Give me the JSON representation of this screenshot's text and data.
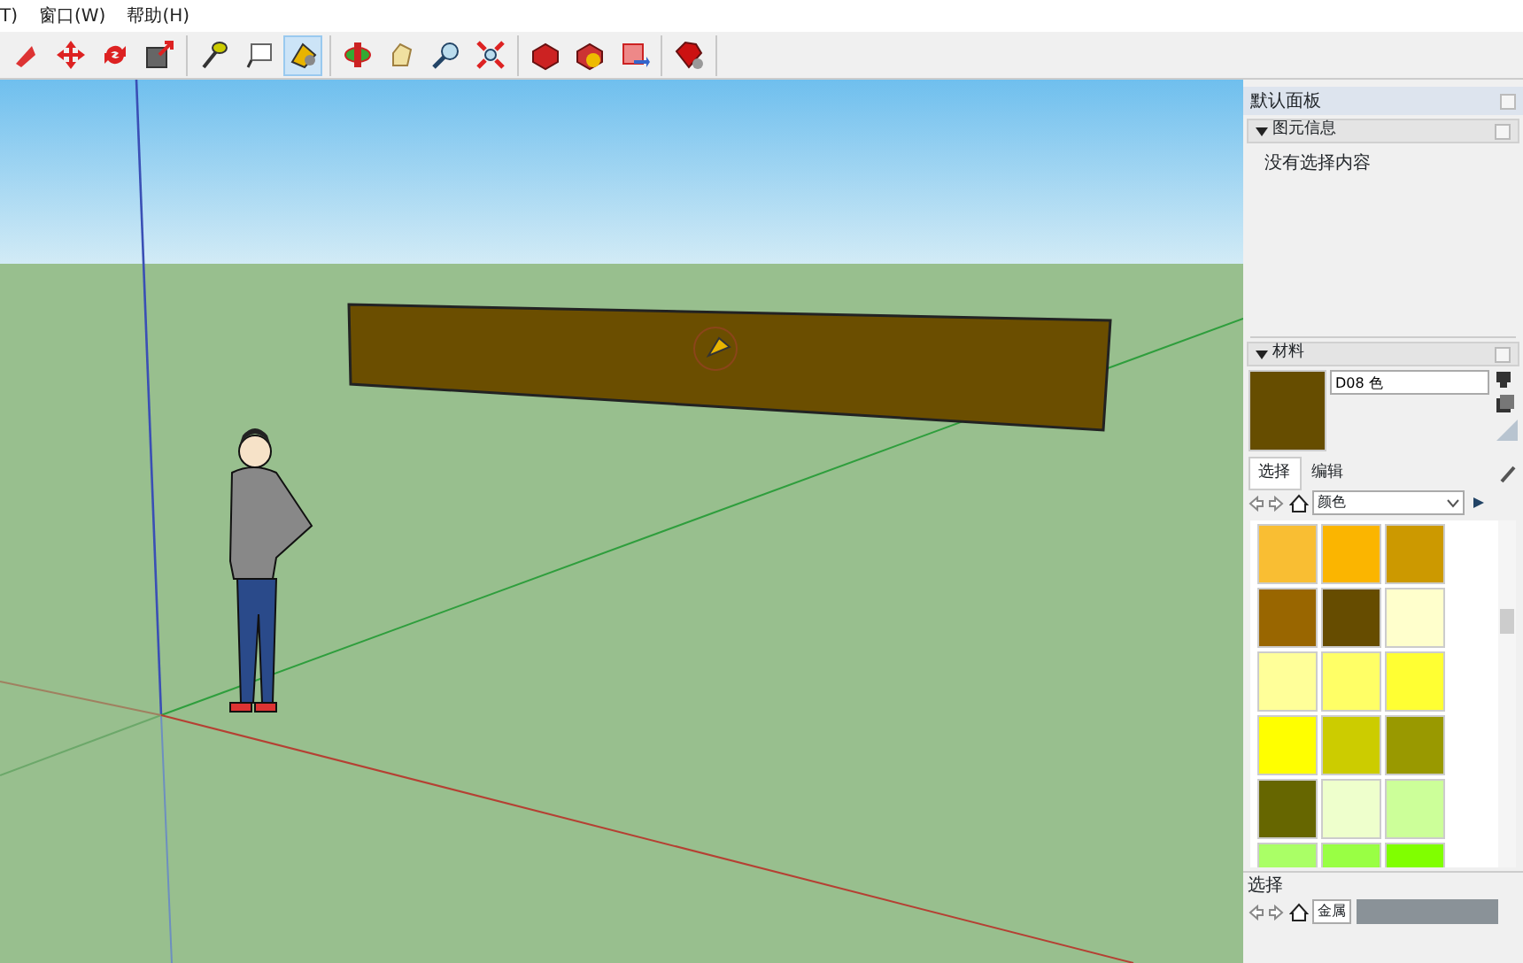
{
  "menu_bar": {
    "items": [
      "T)",
      "窗口(W)",
      "帮助(H)"
    ]
  },
  "toolbar_groups": [
    [
      {
        "selected": false
      },
      {
        "selected": false
      },
      {
        "selected": false
      },
      {
        "selected": false
      }
    ],
    [
      {
        "selected": false
      },
      {
        "selected": false
      },
      {
        "selected": true
      }
    ],
    [
      {
        "selected": false
      },
      {
        "selected": false
      },
      {
        "selected": false
      },
      {
        "selected": false
      }
    ],
    [
      {
        "selected": false
      },
      {
        "selected": false
      },
      {
        "selected": false
      }
    ],
    [
      {
        "selected": false
      }
    ]
  ],
  "tray": {
    "title": "默认面板",
    "entity_info": {
      "title": "图元信息",
      "expanded": true,
      "text": "没有选择内容"
    },
    "materials": {
      "title": "材料",
      "expanded": true,
      "material_name": "D08 色",
      "preview": {
        "color": "#664d00"
      },
      "tabs": [
        {
          "label": "选择",
          "selected": true
        },
        {
          "label": "编辑",
          "selected": false
        }
      ],
      "library": "颜色",
      "swatches": [
        {
          "color": "#f9be33"
        },
        {
          "color": "#fbb500"
        },
        {
          "color": "#cc9900"
        },
        {
          "color": "#996600"
        },
        {
          "color": "#664c00"
        },
        {
          "color": "#ffffcc"
        },
        {
          "color": "#ffff99"
        },
        {
          "color": "#ffff66"
        },
        {
          "color": "#ffff33"
        },
        {
          "color": "#ffff00"
        },
        {
          "color": "#cccc00"
        },
        {
          "color": "#999900"
        },
        {
          "color": "#666600"
        },
        {
          "color": "#eeffcc"
        },
        {
          "color": "#ccff99"
        },
        {
          "color": "#aaff66"
        },
        {
          "color": "#99ff44"
        },
        {
          "color": "#80ff00"
        }
      ],
      "secondary_title": "选择",
      "secondary_library": "金属"
    }
  }
}
